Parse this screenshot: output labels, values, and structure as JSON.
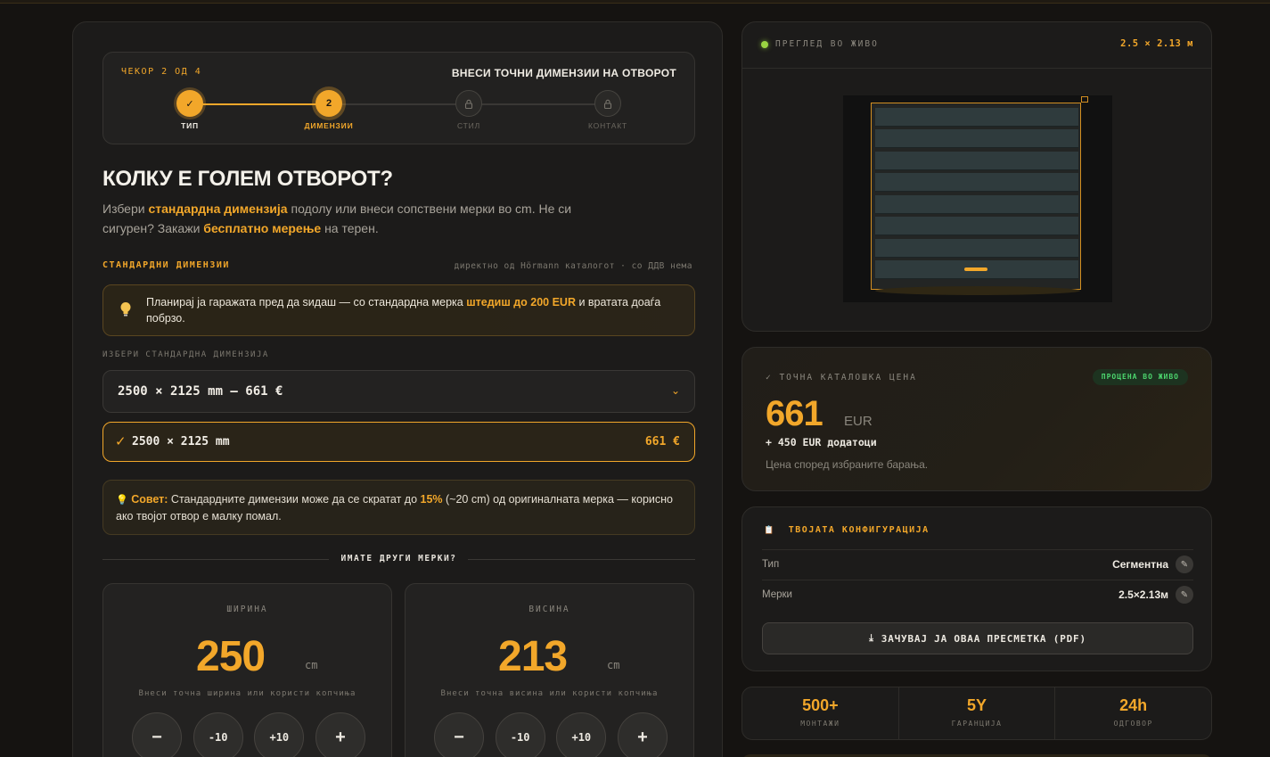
{
  "stepper": {
    "count": "ЧЕКОР 2 ОД 4",
    "heading": "ВНЕСИ ТОЧНИ ДИМЕНЗИИ НА ОТВОРОТ",
    "steps": [
      {
        "label": "ТИП",
        "mark": "✓"
      },
      {
        "label": "ДИМЕНЗИИ",
        "mark": "2"
      },
      {
        "label": "СТИЛ",
        "mark": "🔒"
      },
      {
        "label": "КОНТАКТ",
        "mark": "🔒"
      }
    ]
  },
  "intro": {
    "title": "КОЛКУ Е ГОЛЕМ ОТВОРОТ?",
    "lead_1": "Избери ",
    "lead_b1": "стандардна димензија",
    "lead_2": " подолу или внеси сопствени мерки во cm. Не си сигурен? Закажи ",
    "lead_b2": "бесплатно мерење",
    "lead_3": " на терен."
  },
  "standard": {
    "label": "СТАНДАРДНИ ДИМЕНЗИИ",
    "note": "директно од Hörmann каталогот · со ДДВ нема"
  },
  "tip": {
    "icon": "lightbulb-icon",
    "text_1": "Планирај ја гаражата пред да ѕидаш — со стандардна мерка ",
    "text_b": "штедиш до 200 EUR",
    "text_2": " и вратата доаѓа побрзо."
  },
  "select": {
    "label": "ИЗБЕРИ СТАНДАРДНА ДИМЕНЗИЈА",
    "value": "2500 × 2125 mm — 661 €",
    "chevron": "⌄"
  },
  "chosen": {
    "check": "✓",
    "value": "2500 × 2125 mm",
    "price": "661 €"
  },
  "advice": {
    "icon": "💡",
    "bold": "Совет:",
    "text_1": " Стандардните димензии може да се скратат до ",
    "pct": "15%",
    "text_2": " (~20 cm) од оригиналната мерка — корисно ако твојот отвор е малку помал."
  },
  "custom": {
    "divider": "ИМАТЕ ДРУГИ МЕРКИ?",
    "width": {
      "caption": "ШИРИНА",
      "value": "250",
      "unit": "cm",
      "hint": "Внеси точна ширина или користи копчиња",
      "buttons": [
        "−",
        "-10",
        "+10",
        "+"
      ]
    },
    "height": {
      "caption": "ВИСИНА",
      "value": "213",
      "unit": "cm",
      "hint": "Внеси точна висина или користи копчиња",
      "buttons": [
        "−",
        "-10",
        "+10",
        "+"
      ]
    }
  },
  "preview": {
    "title": "ПРЕГЛЕД ВО ЖИВО",
    "dims": "2.5 × 2.13 м",
    "panel_count": 8
  },
  "price": {
    "caption": "✓ ТОЧНА КАТАЛОШКА ЦЕНА",
    "badge": "ПРОЦЕНА ВО ЖИВО",
    "amount": "661",
    "currency": "EUR",
    "extra": "+ 450 EUR додатоци",
    "note": "Цена според избраните барања."
  },
  "config": {
    "title": "ТВОЈАТА КОНФИГУРАЦИЈА",
    "icon": "📋",
    "rows": [
      {
        "key": "Тип",
        "value": "Сегментна"
      },
      {
        "key": "Мерки",
        "value": "2.5×2.13м"
      }
    ],
    "pdf_label": "ЗАЧУВАЈ ЈА ОВАА ПРЕСМЕТКА (PDF)",
    "pdf_icon": "⤓"
  },
  "stats": [
    {
      "value": "500+",
      "label": "МОНТАЖИ"
    },
    {
      "value": "5Y",
      "label": "ГАРАНЦИЈА"
    },
    {
      "value": "24h",
      "label": "ОДГОВОР"
    }
  ],
  "colors": {
    "accent": "#f2a72a",
    "background": "#151311",
    "panel": "#1c1b1a",
    "live_green": "#4cd66e"
  }
}
